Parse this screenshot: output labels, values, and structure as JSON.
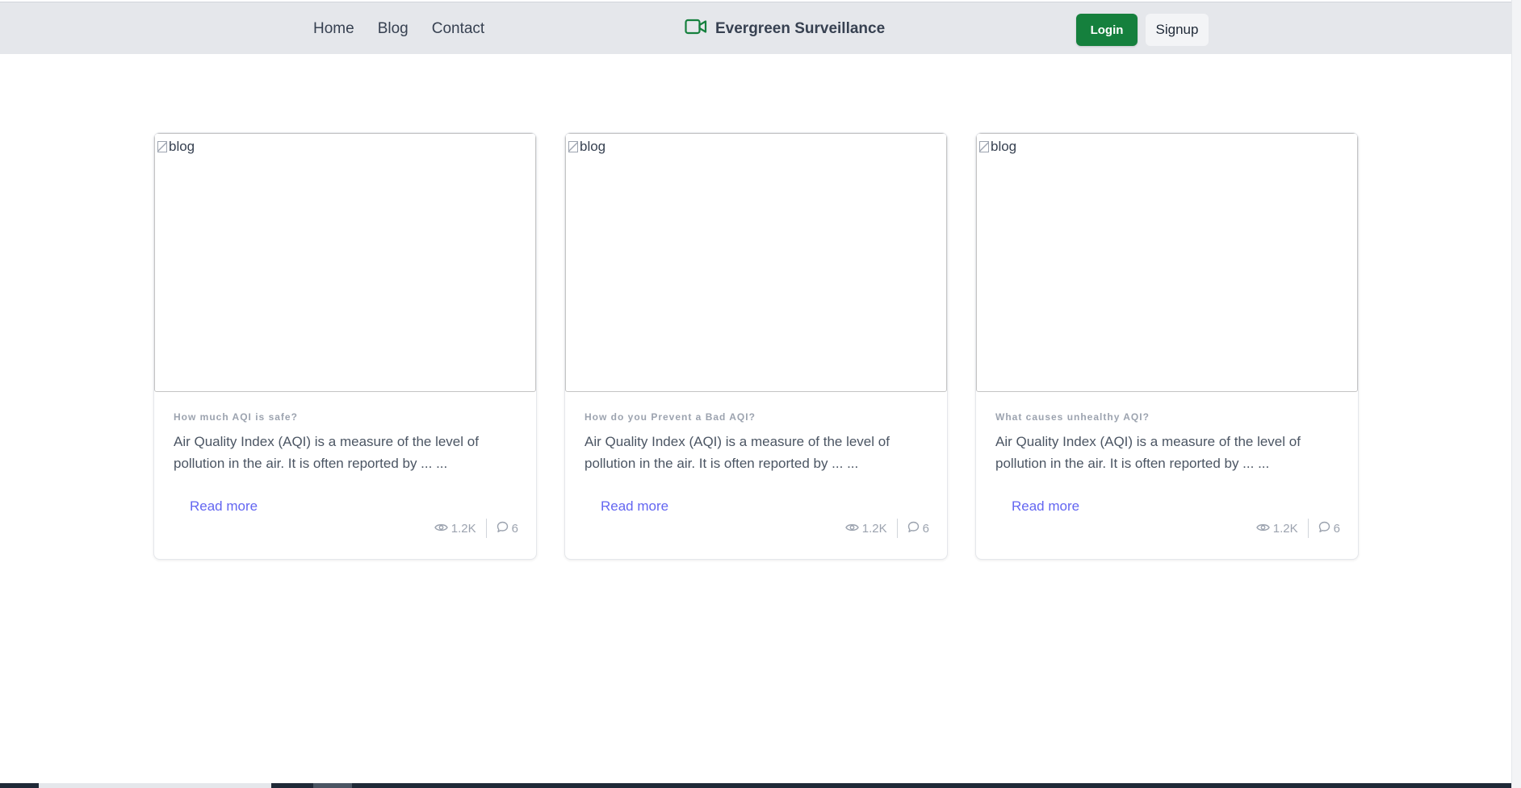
{
  "navbar": {
    "links": [
      {
        "label": "Home"
      },
      {
        "label": "Blog"
      },
      {
        "label": "Contact"
      }
    ],
    "brand": {
      "name": "Evergreen Surveillance",
      "icon": "video-camera-icon",
      "icon_color": "#15803d"
    },
    "login_label": "Login",
    "signup_label": "Signup"
  },
  "cards": [
    {
      "image_alt": "blog",
      "category": "How much AQI is safe?",
      "text": "Air Quality Index (AQI) is a measure of the level of pollution in the air. It is often reported by ... ...",
      "read_more": "Read more",
      "views": "1.2K",
      "comments": "6"
    },
    {
      "image_alt": "blog",
      "category": "How do you Prevent a Bad AQI?",
      "text": "Air Quality Index (AQI) is a measure of the level of pollution in the air. It is often reported by ... ...",
      "read_more": "Read more",
      "views": "1.2K",
      "comments": "6"
    },
    {
      "image_alt": "blog",
      "category": "What causes unhealthy AQI?",
      "text": "Air Quality Index (AQI) is a measure of the level of pollution in the air. It is often reported by ... ...",
      "read_more": "Read more",
      "views": "1.2K",
      "comments": "6"
    }
  ],
  "colors": {
    "accent": "#15803d",
    "link": "#6366f1",
    "navbar_bg": "#e5e7eb"
  }
}
